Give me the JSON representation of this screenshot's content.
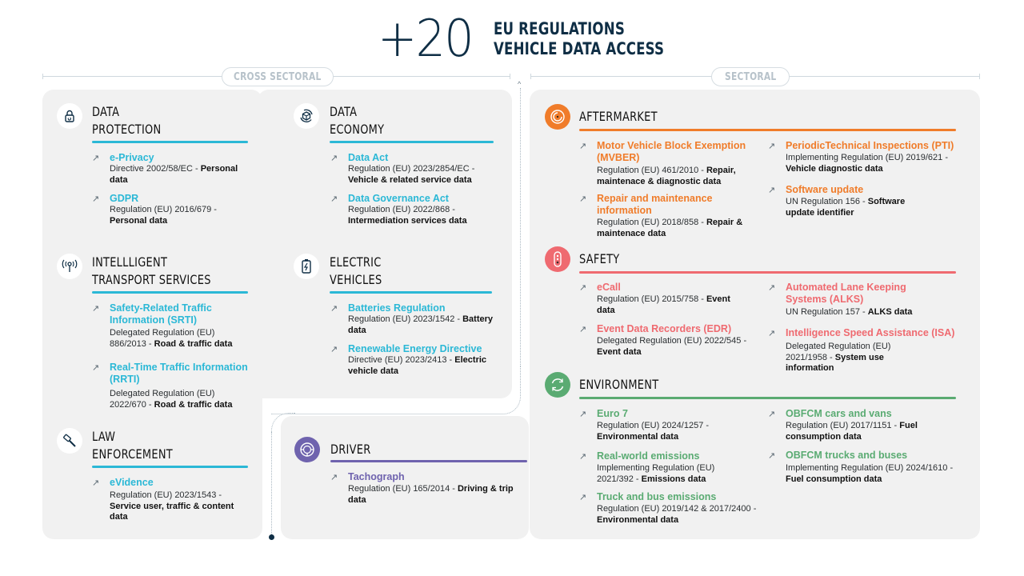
{
  "header": {
    "count": "+20",
    "title_line1": "EU REGULATIONS",
    "title_line2": "VEHICLE DATA ACCESS"
  },
  "labels": {
    "cross_sectoral": "CROSS SECTORAL",
    "sectoral": "SECTORAL"
  },
  "colors": {
    "navy": "#0f2e45",
    "cross_accent": "#2bb8d6",
    "driver": "#6f63ae",
    "aftermarket": "#f07c2a",
    "safety": "#ef6a70",
    "environment": "#5aab72",
    "panel_bg": "#f1f1f1"
  },
  "cross_sectoral": {
    "data_protection": {
      "icon": "lock-icon",
      "title1": "DATA",
      "title2": "PROTECTION",
      "items": [
        {
          "name": "e-Privacy",
          "desc": "Directive 2002/58/EC - ",
          "data": "Personal data"
        },
        {
          "name": "GDPR",
          "desc": "Regulation (EU) 2016/679 - ",
          "data": "Personal data"
        }
      ]
    },
    "data_economy": {
      "icon": "cube-cycle-icon",
      "title1": "DATA",
      "title2": "ECONOMY",
      "items": [
        {
          "name": "Data Act",
          "desc": "Regulation (EU) 2023/2854/EC - ",
          "data": "Vehicle & related service data"
        },
        {
          "name": "Data Governance Act",
          "desc": "Regulation (EU) 2022/868 - ",
          "data": "Intermediation services data"
        }
      ]
    },
    "its": {
      "icon": "antenna-icon",
      "title1": "INTELLLIGENT",
      "title2": "TRANSPORT SERVICES",
      "items": [
        {
          "name": "Safety-Related Traffic Information (SRTI)",
          "desc": "Delegated Regulation (EU) 886/2013 - ",
          "data": "Road & traffic data"
        },
        {
          "name": "Real-Time Traffic Information (RRTI)",
          "desc": "Delegated Regulation (EU) 2022/670 - ",
          "data": "Road & traffic data"
        }
      ]
    },
    "electric_vehicles": {
      "icon": "battery-icon",
      "title1": "ELECTRIC",
      "title2": "VEHICLES",
      "items": [
        {
          "name": "Batteries Regulation",
          "desc": "Regulation (EU) 2023/1542 - ",
          "data": "Battery data"
        },
        {
          "name": "Renewable Energy Directive",
          "desc": "Directive (EU) 2023/2413 - ",
          "data": "Electric vehicle data"
        }
      ]
    },
    "law_enforcement": {
      "icon": "gavel-icon",
      "title1": "LAW",
      "title2": "ENFORCEMENT",
      "items": [
        {
          "name": "eVidence",
          "desc": "Regulation (EU) 2023/1543 - ",
          "data": "Service user, traffic & content data"
        }
      ]
    },
    "driver": {
      "icon": "steering-wheel-icon",
      "title1": "DRIVER",
      "items": [
        {
          "name": "Tachograph",
          "desc": "Regulation (EU) 165/2014 - ",
          "data": "Driving & trip data"
        }
      ]
    }
  },
  "sectoral": {
    "aftermarket": {
      "icon": "target-icon",
      "title": "AFTERMARKET",
      "items": [
        {
          "name": "Motor Vehicle Block Exemption (MVBER)",
          "desc": "Regulation (EU) 461/2010 - ",
          "data": "Repair, maintenace & diagnostic data"
        },
        {
          "name": "Repair and maintenance information",
          "desc": "Regulation (EU) 2018/858 - ",
          "data": "Repair & maintenace data"
        },
        {
          "name": "PeriodicTechnical Inspections (PTI)",
          "desc": "Implementing Regulation (EU)  2019/621 - ",
          "data": "Vehicle diagnostic data"
        },
        {
          "name": "Software update",
          "desc": "UN Regulation 156 - ",
          "data": "Software update identifier"
        }
      ]
    },
    "safety": {
      "icon": "traffic-light-icon",
      "title": "SAFETY",
      "items": [
        {
          "name": "eCall",
          "desc": "Regulation (EU) 2015/758 - ",
          "data": "Event data"
        },
        {
          "name": "Event Data Recorders (EDR)",
          "desc": "Delegated Regulation (EU) 2022/545 - ",
          "data": "Event data"
        },
        {
          "name": "Automated Lane Keeping Systems (ALKS)",
          "desc": "UN Regulation 157 - ",
          "data": "ALKS data"
        },
        {
          "name": "Intelligence Speed Assistance (ISA)",
          "desc": "Delegated Regulation (EU) 2021/1958 - ",
          "data": "System use information"
        }
      ]
    },
    "environment": {
      "icon": "recycle-icon",
      "title": "ENVIRONMENT",
      "items": [
        {
          "name": "Euro 7",
          "desc": "Regulation (EU) 2024/1257 - ",
          "data": "Environmental data"
        },
        {
          "name": "Real-world emissions",
          "desc": "Implementing Regulation (EU) 2021/392 - ",
          "data": "Emissions data"
        },
        {
          "name": "Truck and bus emissions",
          "desc": "Regulation (EU) 2019/142 & 2017/2400 - ",
          "data": "Environmental data"
        },
        {
          "name": "OBFCM cars and vans",
          "desc": "Regulation (EU) 2017/1151 - ",
          "data": "Fuel consumption data"
        },
        {
          "name": "OBFCM trucks and buses",
          "desc": "Implementing Regulation (EU) 2024/1610 - ",
          "data": "Fuel consumption data"
        }
      ]
    }
  }
}
